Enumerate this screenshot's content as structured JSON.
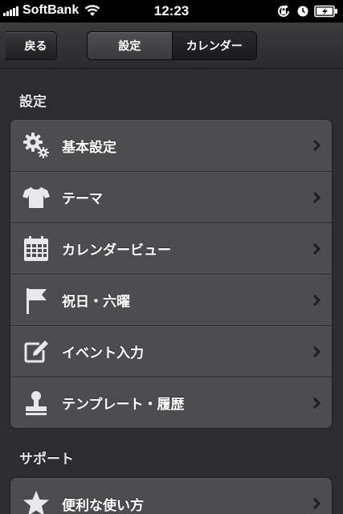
{
  "status_bar": {
    "carrier": "SoftBank",
    "time": "12:23",
    "icons": [
      "signal-icon",
      "wifi-icon",
      "rotation-lock-icon",
      "alarm-icon",
      "battery-charging-icon"
    ]
  },
  "nav": {
    "back_label": "戻る",
    "segments": [
      {
        "label": "設定",
        "selected": true
      },
      {
        "label": "カレンダー",
        "selected": false
      }
    ]
  },
  "sections": [
    {
      "header": "設定",
      "items": [
        {
          "label": "基本設定",
          "icon": "gears-icon"
        },
        {
          "label": "テーマ",
          "icon": "tshirt-icon"
        },
        {
          "label": "カレンダービュー",
          "icon": "calendar-grid-icon"
        },
        {
          "label": "祝日・六曜",
          "icon": "flag-icon"
        },
        {
          "label": "イベント入力",
          "icon": "edit-icon"
        },
        {
          "label": "テンプレート・履歴",
          "icon": "stamp-icon"
        }
      ]
    },
    {
      "header": "サポート",
      "items": [
        {
          "label": "便利な使い方",
          "icon": "star-icon"
        }
      ]
    }
  ],
  "colors": {
    "background": "#2d2d2f",
    "cell": "#4d4d50",
    "text": "#ffffff"
  }
}
